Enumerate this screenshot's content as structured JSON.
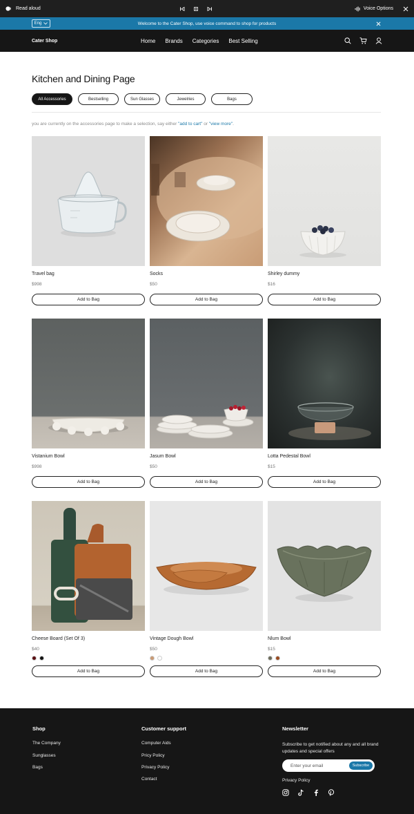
{
  "readbar": {
    "read_aloud": "Read aloud",
    "voice_options": "Voice Options"
  },
  "announce": {
    "lang": "Eng",
    "message": "Welcome to the Cater Shop, use voice command to shop for products"
  },
  "header": {
    "logo": "Cater Shop",
    "nav": [
      "Home",
      "Brands",
      "Categories",
      "Best Selling"
    ]
  },
  "page": {
    "title": "Kitchen and Dining Page",
    "filters": [
      "All Accessories",
      "Bestselling",
      "Sun Glasses",
      "Jewelries",
      "Bags"
    ],
    "hint_prefix": "you are currently on the accessories page to make a selection, say either ",
    "hint_q1": "\"add to cart\"",
    "hint_mid": " or ",
    "hint_q2": "\"view more\"",
    "hint_suffix": "."
  },
  "products": [
    {
      "name": "Travel bag",
      "price": "$998",
      "button": "Add to Bag",
      "swatches": []
    },
    {
      "name": "Socks",
      "price": "$50",
      "button": "Add to Bag",
      "swatches": []
    },
    {
      "name": "Shirley dummy",
      "price": "$16",
      "button": "Add to Bag",
      "swatches": []
    },
    {
      "name": "Vistanium Bowl",
      "price": "$998",
      "button": "Add to Bag",
      "swatches": []
    },
    {
      "name": "Jasum Bowl",
      "price": "$50",
      "button": "Add to Bag",
      "swatches": []
    },
    {
      "name": "Lotta Pedestal Bowl",
      "price": "$15",
      "button": "Add to Bag",
      "swatches": []
    },
    {
      "name": "Cheese Board (Set Of 3)",
      "price": "$40",
      "button": "Add to Bag",
      "swatches": [
        "#5a0f12",
        "#111111"
      ]
    },
    {
      "name": "Vintage Dough Bowl",
      "price": "$50",
      "button": "Add to Bag",
      "swatches": [
        "#c99a74",
        "#ffffff"
      ]
    },
    {
      "name": "Nlum Bowl",
      "price": "$15",
      "button": "Add to Bag",
      "swatches": [
        "#6b6b5a",
        "#9a4a1e"
      ]
    }
  ],
  "footer": {
    "shop_title": "Shop",
    "shop_links": [
      "The Company",
      "Sunglasses",
      "Bags"
    ],
    "support_title": "Customer support",
    "support_links": [
      "Computer Aids",
      "Pricy Policy",
      "Privacy Policy",
      "Contact"
    ],
    "newsletter_title": "Newsletter",
    "newsletter_text": "Subscribe to get notified about any and all brand updates and special offers",
    "email_placeholder": "Enter your email",
    "subscribe": "Subscribe",
    "privacy": "Privacy Policy",
    "social": [
      "instagram-icon",
      "tiktok-icon",
      "facebook-icon",
      "pinterest-icon"
    ]
  },
  "colors": {
    "accent": "#1b78a8",
    "dark": "#161616",
    "readbar": "#1f1f1f"
  }
}
